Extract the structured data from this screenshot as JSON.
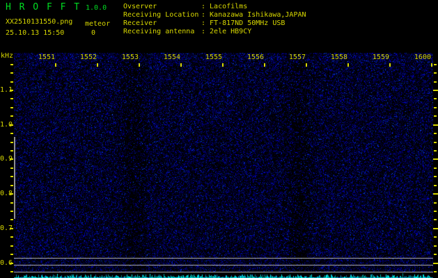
{
  "app": {
    "title": "H R O F F T",
    "version": "1.0.0"
  },
  "file": {
    "name": "XX2510131550.png",
    "datetime": "25.10.13 15:50"
  },
  "counter": {
    "label": "meteor",
    "value": "0"
  },
  "info": {
    "separator": ":",
    "rows": [
      {
        "label": "Ovserver",
        "value": "Lacofilms"
      },
      {
        "label": "Receiving Location",
        "value": "Kanazawa Ishikawa,JAPAN"
      },
      {
        "label": "Receiver",
        "value": "FT-817ND 50MHz USB"
      },
      {
        "label": "Receiving antenna",
        "value": "2ele HB9CY"
      }
    ]
  },
  "chart_data": {
    "type": "heatmap",
    "subtype": "radio-meteor-spectrogram",
    "title": "HROFFT 1.0.0 spectrogram, 25.10.13 15:50 - 16:00, meteor count 0",
    "x": {
      "tick_labels": [
        "1551",
        "1552",
        "1553",
        "1554",
        "1555",
        "1556",
        "1557",
        "1558",
        "1559",
        "1600"
      ],
      "minutes_per_division": 1
    },
    "y": {
      "label": "kHz",
      "tick_labels": [
        "1.1",
        "1.0",
        "0.9",
        "0.8",
        "0.7",
        "0.6"
      ],
      "major_step_khz": 0.1,
      "minor_step_khz": 0.025,
      "top_khz": 1.21,
      "bottom_khz": 0.575
    },
    "reference_lines_khz": [
      0.615,
      0.595,
      0.575
    ],
    "meteor_echo_count": 0,
    "noise": {
      "density": 0.5,
      "palette": [
        "#000033",
        "#000066",
        "#0000aa",
        "#2233ee"
      ]
    },
    "signal_strip": {
      "description": "bottom per-second signal level bars",
      "color": "#00cccc"
    },
    "grid": "off",
    "legend": "none"
  },
  "colors": {
    "text_yellow": "#d8d800",
    "title_green": "#00dd22",
    "reference_gray": "#a8a8a8",
    "signal_cyan": "#00cccc",
    "background": "#000000"
  }
}
